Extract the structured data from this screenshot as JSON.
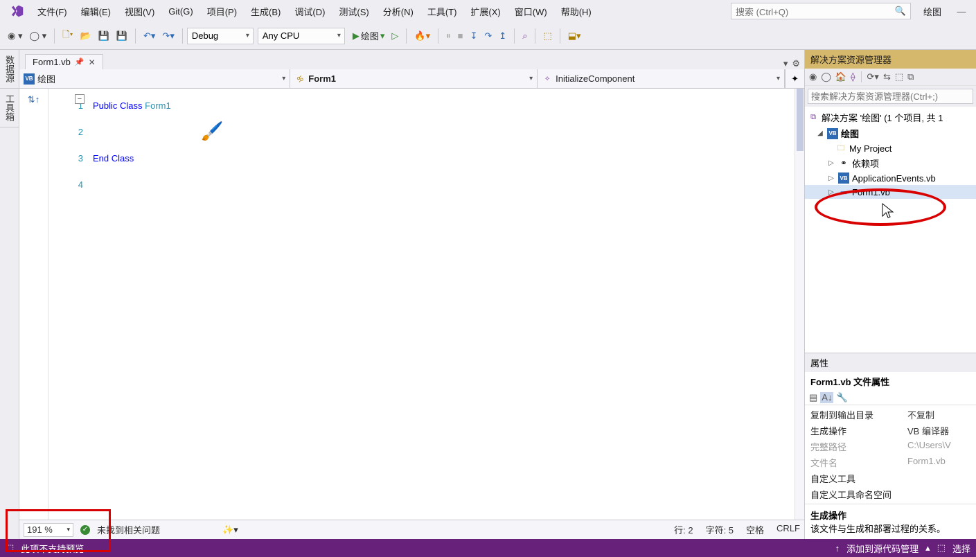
{
  "menu": {
    "items": [
      "文件(F)",
      "编辑(E)",
      "视图(V)",
      "Git(G)",
      "项目(P)",
      "生成(B)",
      "调试(D)",
      "测试(S)",
      "分析(N)",
      "工具(T)",
      "扩展(X)",
      "窗口(W)",
      "帮助(H)"
    ],
    "search_placeholder": "搜索 (Ctrl+Q)",
    "title": "绘图",
    "window_min": "—"
  },
  "toolbar": {
    "config": "Debug",
    "platform": "Any CPU",
    "run_label": "绘图"
  },
  "tabs": {
    "file": "Form1.vb"
  },
  "nav": {
    "scope_icon": "VB",
    "scope": "绘图",
    "class": "Form1",
    "member": "InitializeComponent"
  },
  "code": {
    "lines": [
      "1",
      "2",
      "3",
      "4"
    ],
    "l1_kw1": "Public ",
    "l1_kw2": "Class ",
    "l1_type": "Form1",
    "l3_kw1": "End ",
    "l3_kw2": "Class"
  },
  "editor_status": {
    "zoom": "191 %",
    "issues": "未找到相关问题",
    "line": "行: 2",
    "col": "字符: 5",
    "ins": "空格",
    "eol": "CRLF"
  },
  "solution": {
    "title": "解决方案资源管理器",
    "search_placeholder": "搜索解决方案资源管理器(Ctrl+;)",
    "root": "解决方案 '绘图' (1 个项目, 共 1",
    "project": "绘图",
    "myproject": "My Project",
    "deps": "依赖项",
    "appevents": "ApplicationEvents.vb",
    "form": "Form1.vb"
  },
  "props": {
    "title": "属性",
    "subject": "Form1.vb 文件属性",
    "rows": [
      {
        "k": "复制到输出目录",
        "v": "不复制",
        "dis": false
      },
      {
        "k": "生成操作",
        "v": "VB 编译器",
        "dis": false
      },
      {
        "k": "完整路径",
        "v": "C:\\Users\\V",
        "dis": true
      },
      {
        "k": "文件名",
        "v": "Form1.vb",
        "dis": true
      },
      {
        "k": "自定义工具",
        "v": "",
        "dis": false
      },
      {
        "k": "自定义工具命名空间",
        "v": "",
        "dis": false
      }
    ],
    "help_title": "生成操作",
    "help_text": "该文件与生成和部署过程的关系。"
  },
  "status": {
    "preview": "此项不支持预览",
    "scm": "添加到源代码管理",
    "select": "选择"
  }
}
